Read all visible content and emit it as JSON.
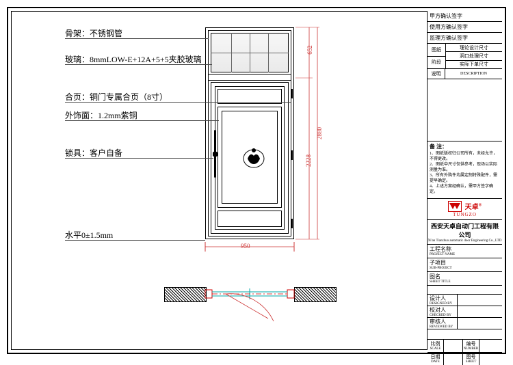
{
  "callouts": {
    "frame": "骨架：不锈钢管",
    "glass": "玻璃：8mmLOW-E+12A+5+5夹胶玻璃",
    "hinge": "合页：铜门专属合页（8寸）",
    "facing": "外饰面：1.2mm紫铜",
    "lock": "锁具：客户自备",
    "level": "水平0±1.5mm"
  },
  "dimensions": {
    "width_bottom": "950",
    "height_total": "2880",
    "height_upper": "652",
    "height_lower": "2228"
  },
  "titleblock": {
    "sign_rows": [
      "甲方确认签字",
      "使用方确认签字",
      "监理方确认签字"
    ],
    "stage_grid_left": [
      "图纸",
      "阶段"
    ],
    "stage_grid_right": [
      "理论设计尺寸",
      "洞口处理尺寸",
      "实际下单尺寸"
    ],
    "desc_left": "说明",
    "desc_right": "DESCRIPTION",
    "notes_title": "备  注：",
    "notes": [
      "1、图纸版权归公司所有，未经允许，不得更改。",
      "2、图纸中尺寸仅供参考，现场以实际测量为准。",
      "3、所有外购件均属定制特殊配件，需提早确定。",
      "4、上述方案经确认，需甲方签字确定。"
    ],
    "brand_cn": "天卓",
    "brand_en": "TUNGZO",
    "brand_r": "®",
    "company_cn": "西安天卓自动门工程有限公司",
    "company_en": "Xi'an Tianzhuo automatic door Engineering Co., LTD",
    "rows": [
      {
        "cn": "工程名称",
        "en": "PROJECT NAME"
      },
      {
        "cn": "子项目",
        "en": "SUB-PROJECT"
      },
      {
        "cn": "图名",
        "en": "SHEET TITLE"
      }
    ],
    "sig_rows": [
      {
        "cn": "设计人",
        "en": "DESIGNED BY"
      },
      {
        "cn": "校对人",
        "en": "CHECKED BY"
      },
      {
        "cn": "审核人",
        "en": "REVIEWED BY"
      }
    ],
    "bottom": {
      "scale_cn": "比例",
      "scale_en": "SCALE",
      "no_cn": "编号",
      "no_en": "NUMBER",
      "date_cn": "日期",
      "date_en": "DATE",
      "sheet_cn": "图号",
      "sheet_en": "SHEET"
    }
  }
}
